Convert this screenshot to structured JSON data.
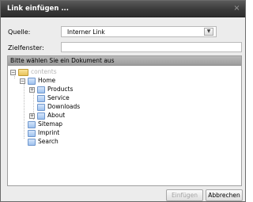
{
  "dialog": {
    "title": "Link einfügen ...",
    "close_glyph": "×"
  },
  "form": {
    "source_label": "Quelle:",
    "source_value": "Interner Link",
    "target_window_label": "Zielfenster:",
    "target_window_value": ""
  },
  "tree": {
    "header": "Bitte wählen Sie ein Dokument aus",
    "root": {
      "label": "contents"
    },
    "items": [
      {
        "label": "Home"
      },
      {
        "label": "Products"
      },
      {
        "label": "Service"
      },
      {
        "label": "Downloads"
      },
      {
        "label": "About"
      },
      {
        "label": "Sitemap"
      },
      {
        "label": "Imprint"
      },
      {
        "label": "Search"
      }
    ],
    "toggles": {
      "collapse": "−",
      "expand": "+"
    }
  },
  "buttons": {
    "insert_label": "Einfügen",
    "cancel_label": "Abbrechen"
  },
  "colors": {
    "titlebar": "#3a3a3a",
    "folder": "#e9c35a",
    "document": "#9fc2ee"
  }
}
